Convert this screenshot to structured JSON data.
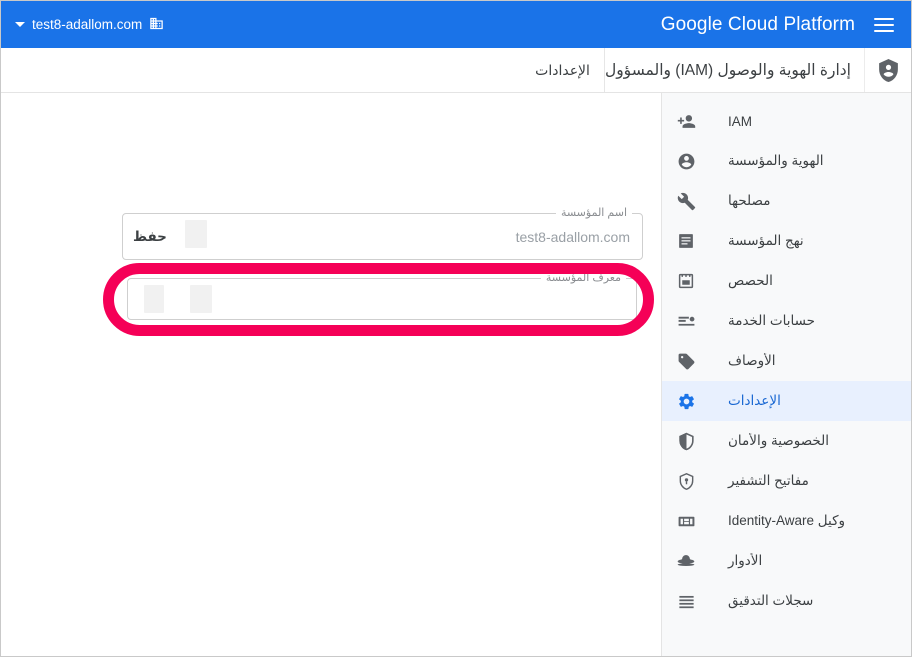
{
  "topbar": {
    "menu_icon": "hamburger-menu-icon",
    "brand": "Google Cloud Platform",
    "org_icon": "organization-building-icon",
    "domain": "test8-adallom.com",
    "caret_icon": "chevron-down-icon",
    "background_color": "#1a73e8"
  },
  "title_row": {
    "icon": "iam-shield-person-icon",
    "heading": "إدارة الهوية والوصول (IAM) والمسؤول",
    "breadcrumb_current": "الإعدادات"
  },
  "sidebar": {
    "background_color": "#f8f9fa",
    "active_color": "#1a73e8",
    "active_row_bg": "#e8f0fe",
    "items": [
      {
        "label": "IAM",
        "icon": "person-add-icon",
        "active": false
      },
      {
        "label": "الهوية والمؤسسة",
        "icon": "account-circle-icon",
        "active": false
      },
      {
        "label": "مصلحها",
        "icon": "wrench-icon",
        "active": false
      },
      {
        "label": "نهج المؤسسة",
        "icon": "list-document-icon",
        "active": false
      },
      {
        "label": "الحصص",
        "icon": "quota-calendar-icon",
        "active": false
      },
      {
        "label": "حسابات الخدمة",
        "icon": "service-account-icon",
        "active": false
      },
      {
        "label": "الأوصاف",
        "icon": "label-tag-icon",
        "active": false
      },
      {
        "label": "الإعدادات",
        "icon": "gear-icon",
        "active": true
      },
      {
        "label": "الخصوصية والأمان",
        "icon": "shield-icon",
        "active": false
      },
      {
        "label": "مفاتيح التشفير",
        "icon": "encryption-key-shield-icon",
        "active": false
      },
      {
        "label": "وكيل Identity-Aware",
        "icon": "iap-proxy-icon",
        "active": false
      },
      {
        "label": "الأدوار",
        "icon": "roles-hat-icon",
        "active": false
      },
      {
        "label": "سجلات التدقيق",
        "icon": "audit-logs-icon",
        "active": false
      }
    ]
  },
  "main": {
    "org_name_field": {
      "label": "اسم المؤسسة",
      "value": "test8-adallom.com",
      "action_label": "حفظ"
    },
    "org_id_field": {
      "label": "معرف المؤسسة",
      "value": "",
      "placeholder": ""
    },
    "highlight": {
      "name": "organization-id-highlight",
      "color": "#f50057"
    }
  }
}
